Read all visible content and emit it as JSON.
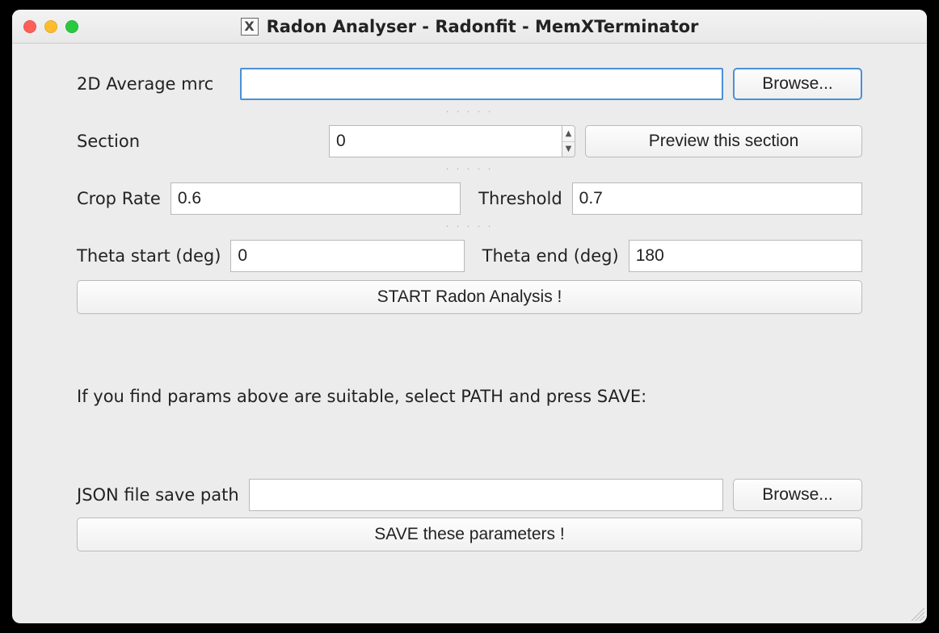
{
  "titlebar": {
    "app_icon_letter": "X",
    "title": "Radon Analyser - Radonfit - MemXTerminator"
  },
  "row_mrc": {
    "label": "2D Average mrc",
    "value": "",
    "browse": "Browse..."
  },
  "row_section": {
    "label": "Section",
    "value": "0",
    "preview": "Preview this section"
  },
  "row_crop_thresh": {
    "crop_label": "Crop Rate",
    "crop_value": "0.6",
    "thresh_label": "Threshold",
    "thresh_value": "0.7"
  },
  "row_theta": {
    "start_label": "Theta start (deg)",
    "start_value": "0",
    "end_label": "Theta end (deg)",
    "end_value": "180"
  },
  "start_button": "START Radon Analysis !",
  "info_text": "If you find params above are suitable, select PATH and press SAVE:",
  "row_json": {
    "label": "JSON file save path",
    "value": "",
    "browse": "Browse..."
  },
  "save_button": "SAVE these parameters !"
}
